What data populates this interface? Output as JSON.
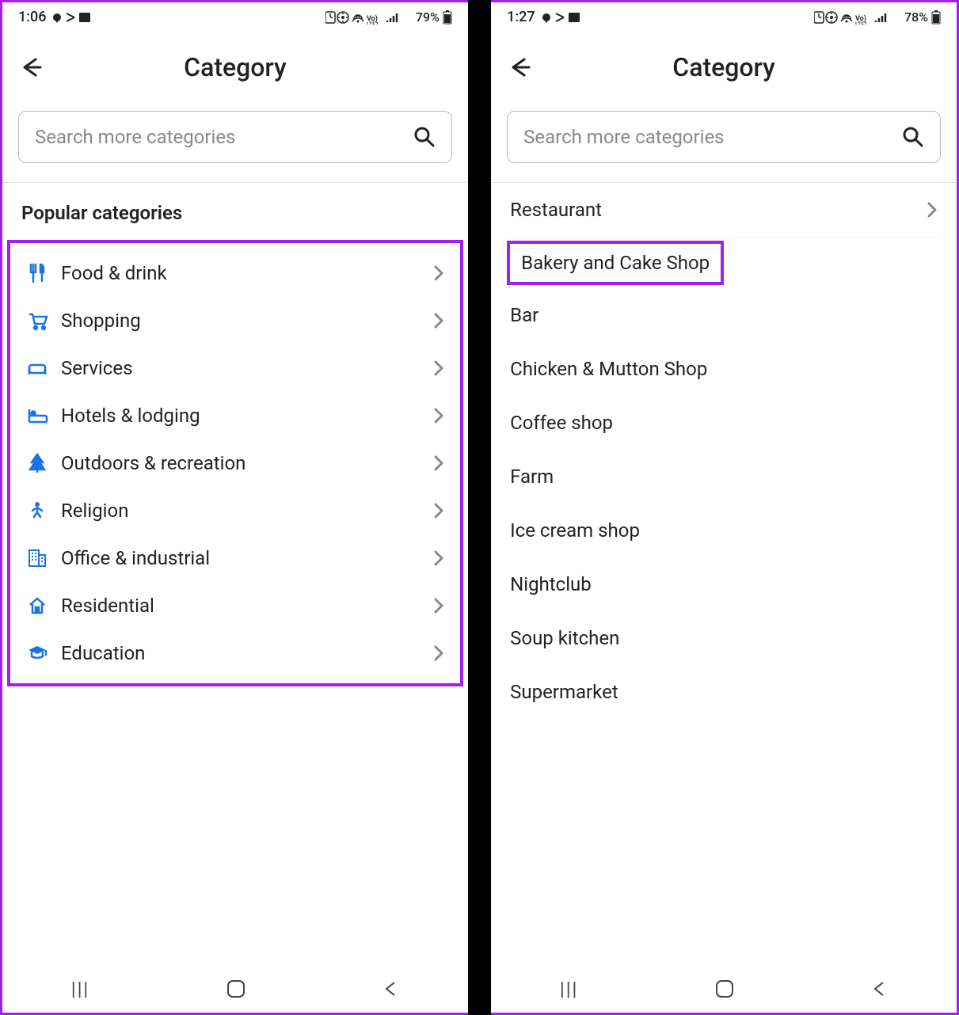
{
  "left": {
    "statusbar": {
      "time": "1:06",
      "battery": "79%"
    },
    "header": {
      "title": "Category"
    },
    "search": {
      "placeholder": "Search more categories"
    },
    "section_title": "Popular categories",
    "categories": [
      {
        "icon": "food",
        "label": "Food & drink"
      },
      {
        "icon": "shopping",
        "label": "Shopping"
      },
      {
        "icon": "services",
        "label": "Services"
      },
      {
        "icon": "hotels",
        "label": "Hotels & lodging"
      },
      {
        "icon": "outdoors",
        "label": "Outdoors & recreation"
      },
      {
        "icon": "religion",
        "label": "Religion"
      },
      {
        "icon": "office",
        "label": "Office & industrial"
      },
      {
        "icon": "residential",
        "label": "Residential"
      },
      {
        "icon": "education",
        "label": "Education"
      }
    ]
  },
  "right": {
    "statusbar": {
      "time": "1:27",
      "battery": "78%"
    },
    "header": {
      "title": "Category"
    },
    "search": {
      "placeholder": "Search more categories"
    },
    "restaurant_label": "Restaurant",
    "highlighted": "Bakery and Cake Shop",
    "subcategories": [
      "Bar",
      "Chicken & Mutton Shop",
      "Coffee shop",
      "Farm",
      "Ice cream shop",
      "Nightclub",
      "Soup kitchen",
      "Supermarket"
    ]
  }
}
